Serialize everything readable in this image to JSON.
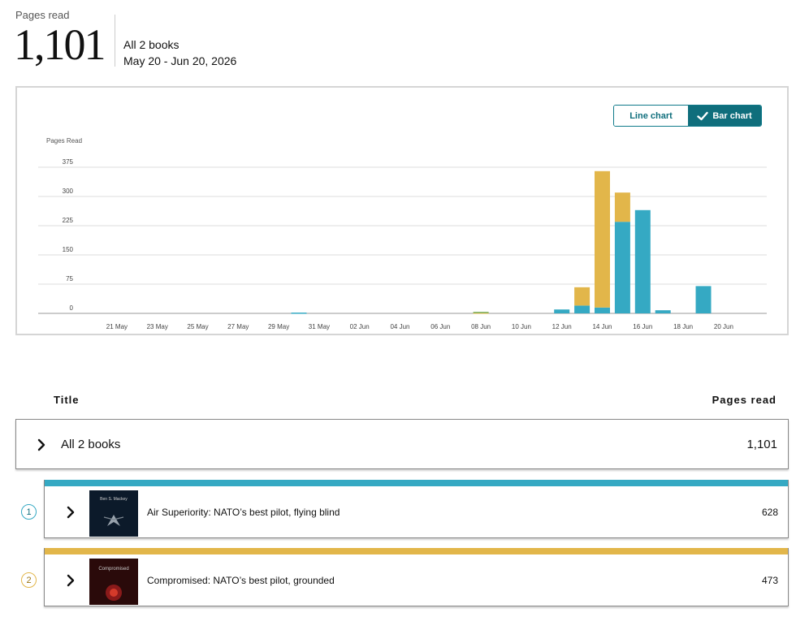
{
  "summary": {
    "label": "Pages read",
    "total": "1,101",
    "books": "All 2 books",
    "date_range": "May 20 - Jun 20, 2026"
  },
  "toggle": {
    "line_label": "Line chart",
    "bar_label": "Bar chart",
    "selected": "bar",
    "accent": "#0f6e7c",
    "icon": "check-icon"
  },
  "chart_data": {
    "type": "bar",
    "stacked": true,
    "ylabel": "Pages Read",
    "ylim": [
      0,
      375
    ],
    "yticks": [
      "375",
      "300",
      "225",
      "150",
      "75",
      "0"
    ],
    "x": [
      "20 May",
      "21 May",
      "22 May",
      "23 May",
      "24 May",
      "25 May",
      "26 May",
      "27 May",
      "28 May",
      "29 May",
      "30 May",
      "31 May",
      "01 Jun",
      "02 Jun",
      "03 Jun",
      "04 Jun",
      "05 Jun",
      "06 Jun",
      "07 Jun",
      "08 Jun",
      "09 Jun",
      "10 Jun",
      "11 Jun",
      "12 Jun",
      "13 Jun",
      "14 Jun",
      "15 Jun",
      "16 Jun",
      "17 Jun",
      "18 Jun",
      "19 Jun",
      "20 Jun"
    ],
    "xticks": [
      "21 May",
      "23 May",
      "25 May",
      "27 May",
      "29 May",
      "31 May",
      "02 Jun",
      "04 Jun",
      "06 Jun",
      "08 Jun",
      "10 Jun",
      "12 Jun",
      "14 Jun",
      "16 Jun",
      "18 Jun",
      "20 Jun"
    ],
    "series": [
      {
        "values": [
          0,
          0,
          0,
          0,
          0,
          0,
          0,
          0,
          0,
          0,
          2,
          0,
          0,
          0,
          0,
          0,
          0,
          0,
          0,
          0,
          0,
          0,
          0,
          10,
          20,
          15,
          235,
          265,
          8,
          0,
          70,
          0
        ],
        "color": "#35a9c3"
      },
      {
        "values": [
          0,
          0,
          0,
          0,
          0,
          0,
          0,
          0,
          0,
          0,
          0,
          0,
          0,
          0,
          0,
          0,
          0,
          0,
          0,
          2,
          0,
          0,
          0,
          0,
          47,
          350,
          75,
          0,
          0,
          0,
          0,
          0
        ],
        "color": "#e2b64a"
      },
      {
        "values": [
          0,
          0,
          0,
          0,
          0,
          0,
          0,
          0,
          0,
          0,
          0,
          0,
          0,
          0,
          0,
          0,
          0,
          0,
          0,
          2,
          0,
          0,
          0,
          0,
          0,
          0,
          0,
          0,
          0,
          0,
          0,
          0
        ],
        "color": "#7cb36a"
      }
    ],
    "grid": true,
    "legend": "none"
  },
  "table": {
    "title_header": "Title",
    "pages_header": "Pages read",
    "all_row": {
      "label": "All 2 books",
      "count": "1,101"
    },
    "books": [
      {
        "rank": "1",
        "title": "Air Superiority: NATO’s best pilot, flying blind",
        "count": "628",
        "color": "#35a9c3",
        "cover_text": "Ben S. Mackey",
        "cover_color": "#0c1a2a"
      },
      {
        "rank": "2",
        "title": "Compromised: NATO’s best pilot, grounded",
        "count": "473",
        "color": "#e2b64a",
        "cover_text": "Compromised",
        "cover_color": "#2a0a0a"
      }
    ]
  }
}
